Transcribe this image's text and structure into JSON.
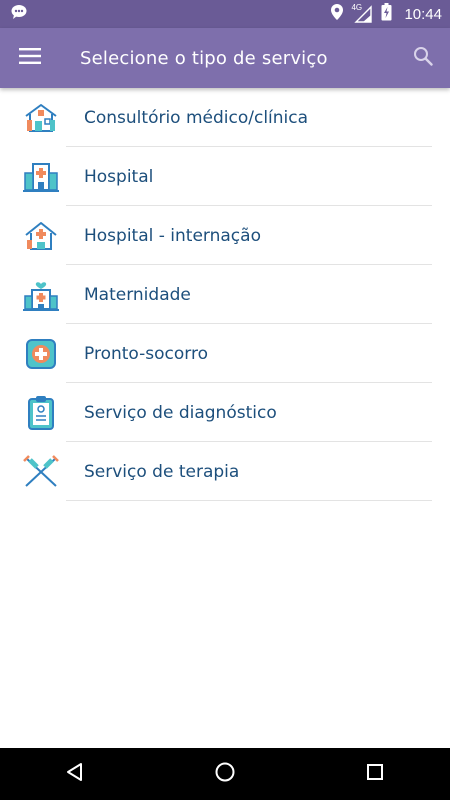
{
  "status_bar": {
    "time": "10:44",
    "network": "4G",
    "icons": [
      "notification-icon",
      "location-icon",
      "signal-icon",
      "battery-icon"
    ]
  },
  "app_bar": {
    "title": "Selecione o tipo de serviço",
    "menu_icon": "hamburger-menu-icon",
    "search_icon": "search-icon"
  },
  "service_types": [
    {
      "label": "Consultório médico/clínica",
      "icon": "clinic-house-icon"
    },
    {
      "label": "Hospital",
      "icon": "hospital-icon"
    },
    {
      "label": "Hospital - internação",
      "icon": "hospital-stay-icon"
    },
    {
      "label": "Maternidade",
      "icon": "maternity-icon"
    },
    {
      "label": "Pronto-socorro",
      "icon": "emergency-icon"
    },
    {
      "label": "Serviço de diagnóstico",
      "icon": "diagnostic-clipboard-icon"
    },
    {
      "label": "Serviço de terapia",
      "icon": "therapy-syringes-icon"
    }
  ],
  "colors": {
    "status_bar": "#6a5b96",
    "app_bar": "#7e6fac",
    "label_text": "#1d4f7c",
    "icon_blue": "#2f7fc0",
    "icon_orange": "#f08a5d",
    "icon_teal": "#4ec3c9"
  },
  "nav_bar": {
    "buttons": [
      "back-icon",
      "home-icon",
      "recents-icon"
    ]
  }
}
